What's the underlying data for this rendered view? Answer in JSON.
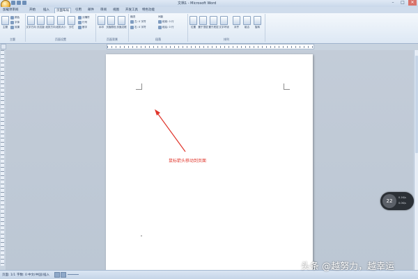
{
  "window": {
    "title": "文档1 - Microsoft Word",
    "controls": [
      "–",
      "□",
      "✕"
    ]
  },
  "tabs": [
    {
      "label": "加载项审阅"
    },
    {
      "label": "开始"
    },
    {
      "label": "插入"
    },
    {
      "label": "页面布局",
      "active": true
    },
    {
      "label": "引用"
    },
    {
      "label": "邮件"
    },
    {
      "label": "审阅"
    },
    {
      "label": "视图"
    },
    {
      "label": "开发工具"
    },
    {
      "label": "特色功能"
    }
  ],
  "ribbon": {
    "groups": [
      {
        "label": "主题"
      },
      {
        "label": "页面设置"
      },
      {
        "label": "页面背景"
      },
      {
        "label": "段落"
      },
      {
        "label": "排列"
      }
    ],
    "theme": {
      "buttons": [
        "主题"
      ],
      "small": [
        "颜色",
        "字体",
        "效果"
      ]
    },
    "page_setup": {
      "buttons": [
        "文字方向",
        "页边距",
        "纸张方向",
        "纸张大小",
        "分栏"
      ],
      "small": [
        "分隔符",
        "行号",
        "断字"
      ]
    },
    "background": {
      "buttons": [
        "水印",
        "页面颜色",
        "页面边框"
      ]
    },
    "paragraph": {
      "indent_label": "缩进",
      "spacing_label": "间距",
      "left": "左: 0 字符",
      "right": "右: 0 字符",
      "before": "段前: 0 行",
      "after": "段后: 0 行"
    },
    "arrange": {
      "buttons": [
        "位置",
        "置于顶层",
        "置于底层",
        "文字环绕",
        "对齐",
        "组合",
        "旋转"
      ]
    }
  },
  "document": {
    "annotation": "鼠标箭头移动到页面"
  },
  "widget": {
    "value": "22",
    "line1": "0.1K/s",
    "line2": "0.0K/s"
  },
  "status": {
    "page": "页面: 1/1",
    "words": "字数: 0",
    "lang": "中文(中国)",
    "mode": "插入"
  },
  "watermark": "头条 @越努力，越幸运",
  "colors": {
    "accent": "#e0352b",
    "ribbon": "#dde8f4",
    "background": "#c3ccd8"
  }
}
